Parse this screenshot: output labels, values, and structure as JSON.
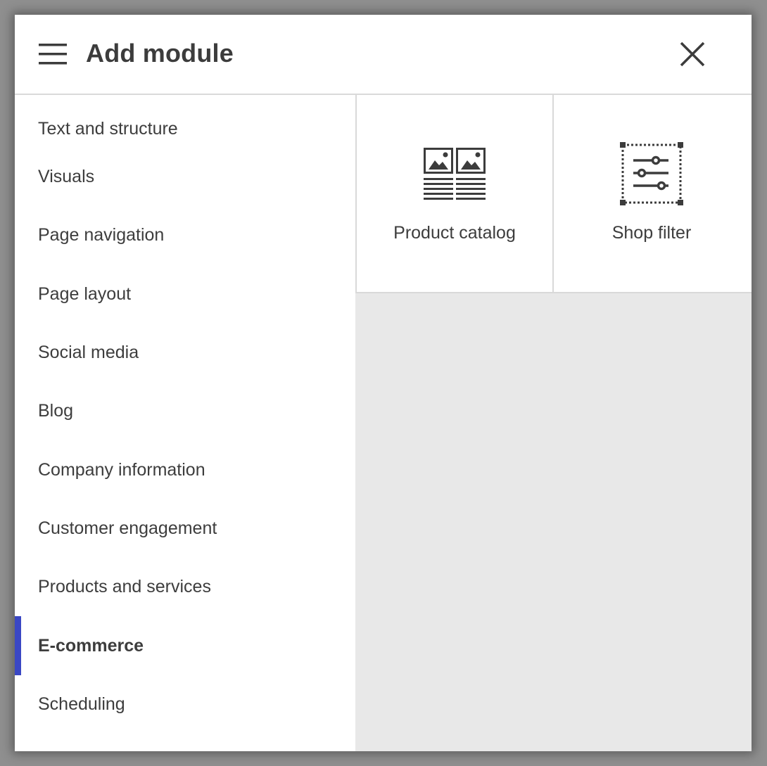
{
  "header": {
    "title": "Add module",
    "menu_icon": "hamburger-menu-icon",
    "close_icon": "close-icon"
  },
  "sidebar": {
    "items": [
      {
        "label": "Text and structure"
      },
      {
        "label": "Visuals"
      },
      {
        "label": "Page navigation"
      },
      {
        "label": "Page layout"
      },
      {
        "label": "Social media"
      },
      {
        "label": "Blog"
      },
      {
        "label": "Company information"
      },
      {
        "label": "Customer engagement"
      },
      {
        "label": "Products and services"
      },
      {
        "label": "E-commerce",
        "selected": true
      },
      {
        "label": "Scheduling"
      }
    ]
  },
  "modules": [
    {
      "label": "Product catalog",
      "icon": "product-catalog-icon"
    },
    {
      "label": "Shop filter",
      "icon": "shop-filter-icon"
    }
  ],
  "colors": {
    "accent": "#3a47c4",
    "text": "#3d3d3d",
    "panel_background": "#e8e8e8",
    "divider": "#d9d9d9"
  }
}
